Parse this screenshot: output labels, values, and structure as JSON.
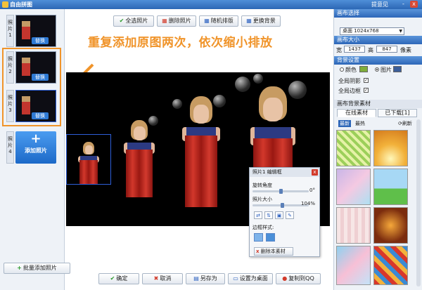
{
  "app": {
    "title": "自由拼图",
    "feedback_label": "提意见",
    "minimize": "-",
    "close": "x"
  },
  "slots": [
    {
      "num": "照片1",
      "replace_label": "替换"
    },
    {
      "num": "照片2",
      "replace_label": "替换"
    },
    {
      "num": "照片3",
      "replace_label": "替换"
    },
    {
      "num": "照片4"
    }
  ],
  "left": {
    "add_photo_plus": "+",
    "add_photo_label": "添加照片",
    "batch_add_label": "批量添加照片",
    "batch_add_icon": "+"
  },
  "toolbar": [
    {
      "name": "select-all-button",
      "icon": "✔",
      "label": "全选照片"
    },
    {
      "name": "delete-photo-button",
      "icon": "▦",
      "label": "删除照片"
    },
    {
      "name": "random-layout-button",
      "icon": "▦",
      "label": "随机排版"
    },
    {
      "name": "change-background-button",
      "icon": "▦",
      "label": "更换背景"
    }
  ],
  "annotation": "重复添加原图两次，依次缩小排放",
  "editor": {
    "title": "照片1 编辑框",
    "close": "x",
    "rotate_label": "旋转角度",
    "rotate_value": "0°",
    "rotate_fraction": 0.5,
    "size_label": "照片大小",
    "size_value": "104%",
    "size_fraction": 0.52,
    "border_label": "边框样式:",
    "delete_label": "删除本素材",
    "delete_icon": "x",
    "tools": [
      "⇄",
      "⇅",
      "▣",
      "✎"
    ]
  },
  "bottom": [
    {
      "name": "confirm-button",
      "icon": "✔",
      "label": "确定",
      "color": "#2a9a2a"
    },
    {
      "name": "cancel-button",
      "icon": "✖",
      "label": "取消",
      "color": "#d23a2a"
    },
    {
      "name": "save-as-button",
      "icon": "▤",
      "label": "另存为",
      "color": "#2d62c1"
    },
    {
      "name": "set-desktop-button",
      "icon": "▭",
      "label": "设置为桌面",
      "color": "#2d62c1"
    },
    {
      "name": "copy-to-qq-button",
      "icon": "●",
      "label": "复制到QQ",
      "color": "#d23a2a"
    }
  ],
  "right": {
    "canvas_select_header": "画布选择",
    "canvas_select_value": "桌面  1024x768",
    "canvas_size_header": "画布大小",
    "width_label": "宽",
    "width_value": "1437",
    "height_label": "高",
    "height_value": "847",
    "unit": "像素",
    "bg_header": "背景设置",
    "bg_color_label": "颜色",
    "bg_image_label": "图片",
    "shadow_label": "全局阴影",
    "border_label": "全局边框",
    "bg_material_header": "画布背景素材",
    "tab_online": "在线素材",
    "tab_downloaded": "已下载[1]",
    "sub_newest": "最新",
    "sub_hottest": "最热",
    "refresh_label": "刷新",
    "accent": "#2d66b8",
    "bg_swatch_color": "#7fae3a"
  }
}
